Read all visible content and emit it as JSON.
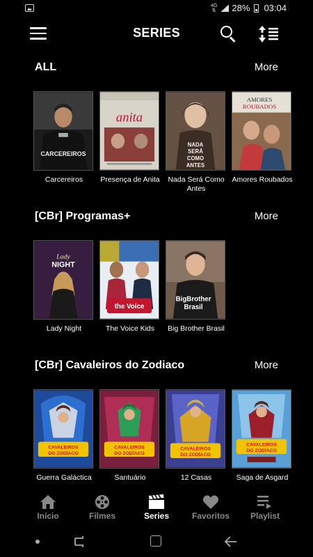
{
  "status_bar": {
    "network": "4G",
    "battery": "28%",
    "time": "03:04"
  },
  "app_bar": {
    "title": "SERIES",
    "menu_icon": "hamburger-menu-icon",
    "search_icon": "search-icon",
    "sort_icon": "sort-icon"
  },
  "sections": [
    {
      "title": "ALL",
      "more_label": "More",
      "items": [
        {
          "title": "Carcereiros",
          "poster_text": "CARCEREIROS"
        },
        {
          "title": "Presença de Anita",
          "poster_text": "anita"
        },
        {
          "title": "Nada Será Como Antes",
          "poster_text": "NADA SERÁ COMO ANTES"
        },
        {
          "title": "Amores Roubados",
          "poster_text": "AMORES ROUBADOS"
        }
      ]
    },
    {
      "title": "[CBr] Programas+",
      "more_label": "More",
      "items": [
        {
          "title": "Lady Night",
          "poster_text": "Lady NIGHT"
        },
        {
          "title": "The Voice Kids",
          "poster_text": "the Voice Kids"
        },
        {
          "title": "Big Brother Brasil",
          "poster_text": "Big Brother Brasil"
        }
      ]
    },
    {
      "title": "[CBr] Cavaleiros do Zodiaco",
      "more_label": "More",
      "items": [
        {
          "title": "Guerra Galáctica",
          "poster_text": "Os Cavaleiros do Zodíaco"
        },
        {
          "title": "Santuário",
          "poster_text": "Os Cavaleiros do Zodíaco"
        },
        {
          "title": "12 Casas",
          "poster_text": "Os Cavaleiros do Zodíaco"
        },
        {
          "title": "Saga de Asgard",
          "poster_text": "Os Cavaleiros do Zodíaco"
        }
      ]
    }
  ],
  "bottom_nav": [
    {
      "label": "Início",
      "icon": "home-icon",
      "active": false
    },
    {
      "label": "Filmes",
      "icon": "film-reel-icon",
      "active": false
    },
    {
      "label": "Series",
      "icon": "clapperboard-icon",
      "active": true
    },
    {
      "label": "Favoritos",
      "icon": "heart-icon",
      "active": false
    },
    {
      "label": "Playlist",
      "icon": "playlist-icon",
      "active": false
    }
  ]
}
